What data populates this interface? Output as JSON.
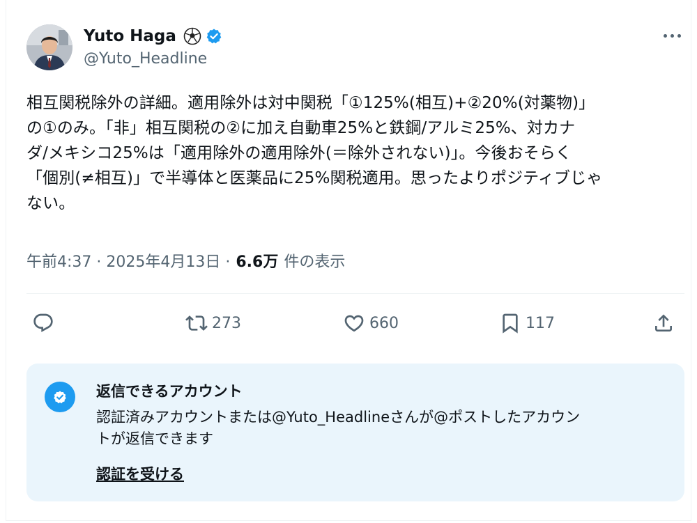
{
  "author": {
    "name": "Yuto Haga",
    "handle": "@Yuto_Headline",
    "badges": [
      "soccer-ball-icon",
      "verified-badge-icon"
    ]
  },
  "tweet": {
    "lines": [
      "相互関税除外の詳細。適用除外は対中関税「①125%(相互)+②20%(対薬物)」",
      "の①のみ。「非」相互関税の②に加え自動車25%と鉄鋼/アルミ25%、対カナ",
      "ダ/メキシコ25%は「適用除外の適用除外(＝除外されない)」。今後おそらく",
      "「個別(≠相互)」で半導体と医薬品に25%関税適用。思ったよりポジティブじゃ",
      "ない。"
    ]
  },
  "meta": {
    "timestamp": "午前4:37 · 2025年4月13日 ·",
    "views": "6.6万",
    "views_label": "件の表示"
  },
  "actions": {
    "reply": {
      "icon": "reply-icon",
      "count": ""
    },
    "retweet": {
      "icon": "retweet-icon",
      "count": "273"
    },
    "like": {
      "icon": "heart-icon",
      "count": "660"
    },
    "bookmark": {
      "icon": "bookmark-icon",
      "count": "117"
    },
    "share": {
      "icon": "share-icon",
      "count": ""
    }
  },
  "reply_restriction": {
    "title": "返信できるアカウント",
    "description_lines": [
      "認証済みアカウントまたは@Yuto_Headlineさんが@ポストしたアカウン",
      "トが返信できます"
    ],
    "link": "認証を受ける"
  },
  "colors": {
    "text": "#0f1419",
    "secondary": "#536471",
    "verified": "#1d9bf0",
    "reply_box_bg": "#eaf5fc"
  }
}
